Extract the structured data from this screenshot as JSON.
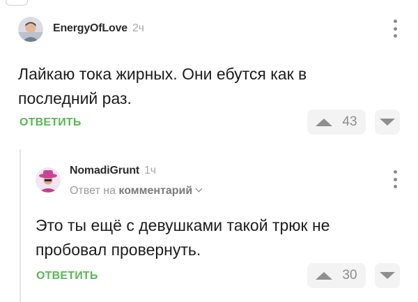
{
  "comments": [
    {
      "author": "EnergyOfLove",
      "time": "2ч",
      "text_lines": [
        "Лайкаю тока жирных. Они ебутся как в",
        "последний раз."
      ],
      "reply_label": "ОТВЕТИТЬ",
      "rating": "43"
    },
    {
      "author": "NomadiGrunt",
      "time": "1ч",
      "reply_to_prefix": "Ответ на",
      "reply_to_link": "комментарий",
      "text_lines": [
        "Это ты ещё с девушками такой трюк не",
        "пробовал провернуть."
      ],
      "reply_label": "ОТВЕТИТЬ",
      "rating": "30"
    }
  ],
  "colors": {
    "accent_green": "#5bb556",
    "muted": "#8f8f8f",
    "vote_bg": "#f3f3f3"
  },
  "icons": [
    "avatar",
    "kebab-menu-icon",
    "upvote-icon",
    "downvote-icon",
    "chevron-down-icon"
  ]
}
